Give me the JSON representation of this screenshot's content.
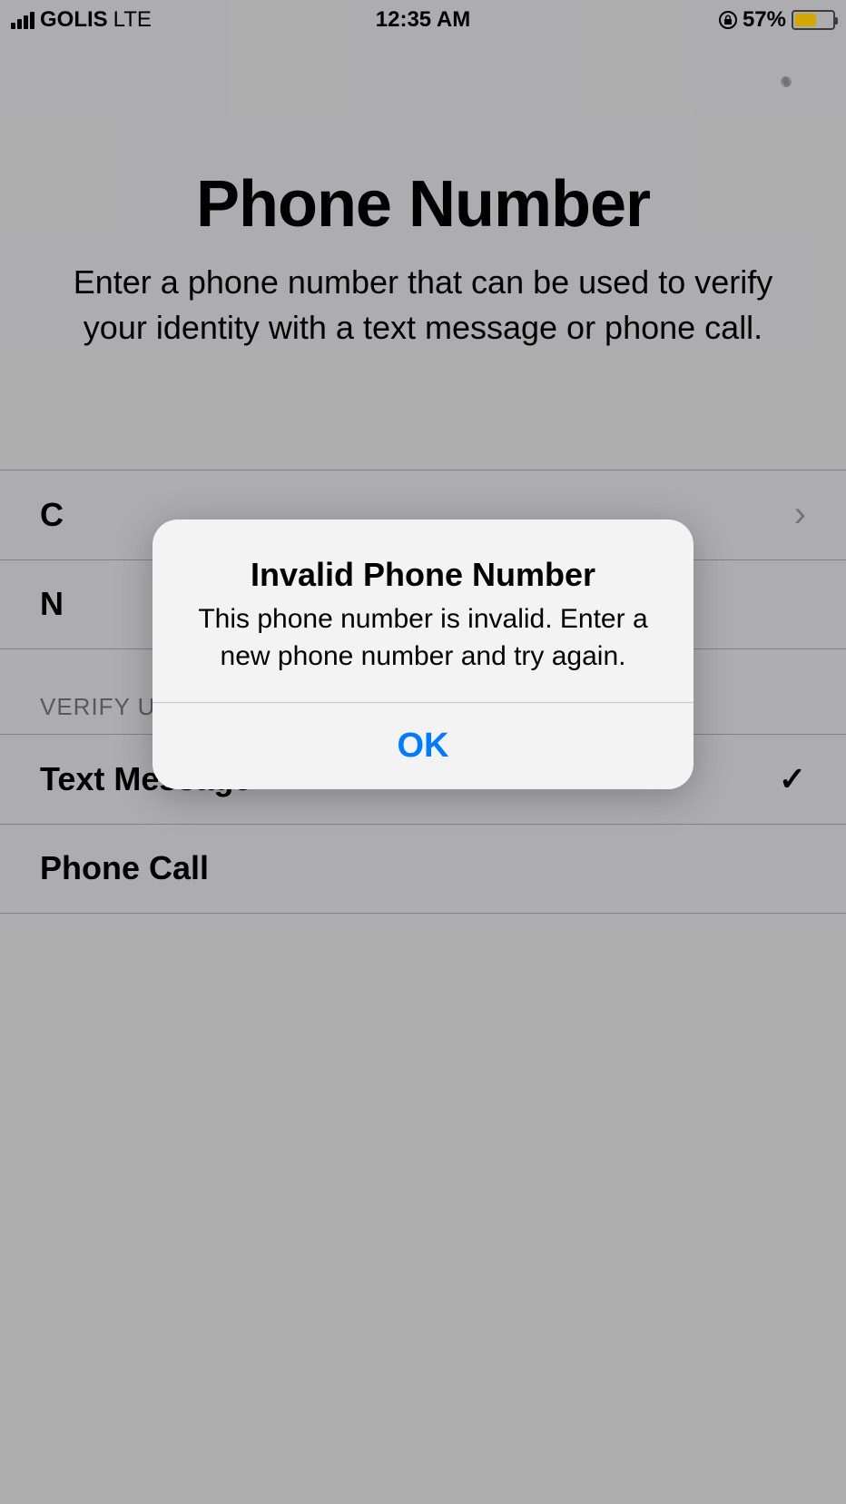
{
  "statusBar": {
    "carrier": "GOLIS",
    "network": "LTE",
    "time": "12:35 AM",
    "batteryPercent": "57%"
  },
  "header": {
    "title": "Phone Number",
    "subtitle": "Enter a phone number that can be used to verify your identity with a text message or phone call."
  },
  "form": {
    "countryRowPrefix": "C",
    "numberRowPrefix": "N",
    "sectionLabel": "VERIFY USING:",
    "options": [
      {
        "label": "Text Message",
        "selected": true
      },
      {
        "label": "Phone Call",
        "selected": false
      }
    ]
  },
  "alert": {
    "title": "Invalid Phone Number",
    "message": "This phone number is invalid. Enter a new phone number and try again.",
    "button": "OK"
  }
}
